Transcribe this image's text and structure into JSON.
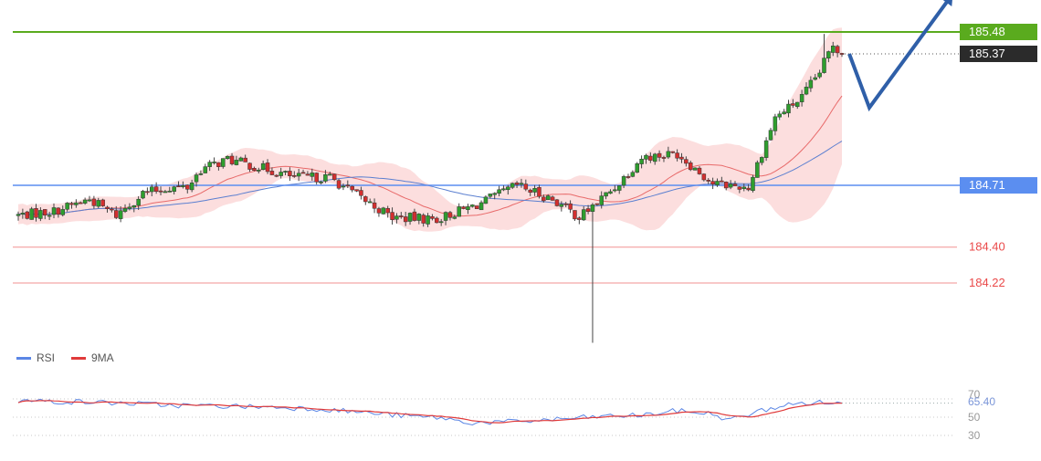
{
  "chart_data": [
    {
      "type": "candlestick",
      "title": "",
      "xlabel": "",
      "ylabel": "",
      "ylim": [
        183.85,
        185.6
      ],
      "grid": false,
      "price_levels": [
        {
          "label": "185.48",
          "value": 185.48,
          "role": "target",
          "color": "#5aab1e"
        },
        {
          "label": "185.37",
          "value": 185.37,
          "role": "last-price",
          "color": "#2b2b2b"
        },
        {
          "label": "184.71",
          "value": 184.71,
          "role": "pivot",
          "color": "#5b8ef0"
        },
        {
          "label": "184.40",
          "value": 184.4,
          "role": "support",
          "color": "#ea4a4a"
        },
        {
          "label": "184.22",
          "value": 184.22,
          "role": "support",
          "color": "#ea4a4a"
        }
      ],
      "forecast_path": [
        185.37,
        185.1,
        185.65
      ],
      "colors": {
        "up": "#2e9e2e",
        "down": "#d32f2f",
        "bollinger_fill": "#fbd3d3",
        "ma_fast": "#e86a6a",
        "ma_slow": "#5b7fd0",
        "arrow": "#2f5fa8"
      }
    },
    {
      "type": "line",
      "title": "",
      "legend": [
        {
          "name": "RSI",
          "color": "#5b86e5"
        },
        {
          "name": "9MA",
          "color": "#e03a3a"
        }
      ],
      "yticks": [
        "70",
        "50",
        "30"
      ],
      "ylim": [
        25,
        75
      ],
      "current_label": "65.40",
      "current_value": 65.4
    }
  ]
}
